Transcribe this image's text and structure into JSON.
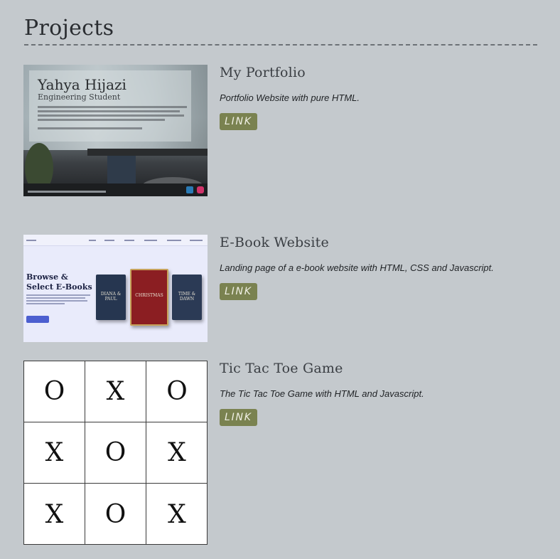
{
  "page": {
    "title": "Projects"
  },
  "projects": [
    {
      "title": "My Portfolio",
      "description": "Portfolio Website with pure HTML.",
      "link_label": "LINK",
      "thumbnail": {
        "name": "Yahya Hijazi",
        "role": "Engineering Student"
      }
    },
    {
      "title": "E-Book Website",
      "description": "Landing page of a e-book website with HTML, CSS and Javascript.",
      "link_label": "LINK",
      "thumbnail": {
        "headline_line1": "Browse &",
        "headline_line2": "Select E-Books",
        "book_left": "DIANA & PAUL",
        "book_center": "CHRISTMAS",
        "book_right": "TIME & DAWN"
      }
    },
    {
      "title": "Tic Tac Toe Game",
      "description": "The Tic Tac Toe Game with HTML and Javascript.",
      "link_label": "LINK",
      "board": [
        "O",
        "X",
        "O",
        "X",
        "O",
        "X",
        "X",
        "O",
        "X"
      ]
    }
  ],
  "colors": {
    "background": "#c4c9cd",
    "link_button": "#7a8250"
  }
}
